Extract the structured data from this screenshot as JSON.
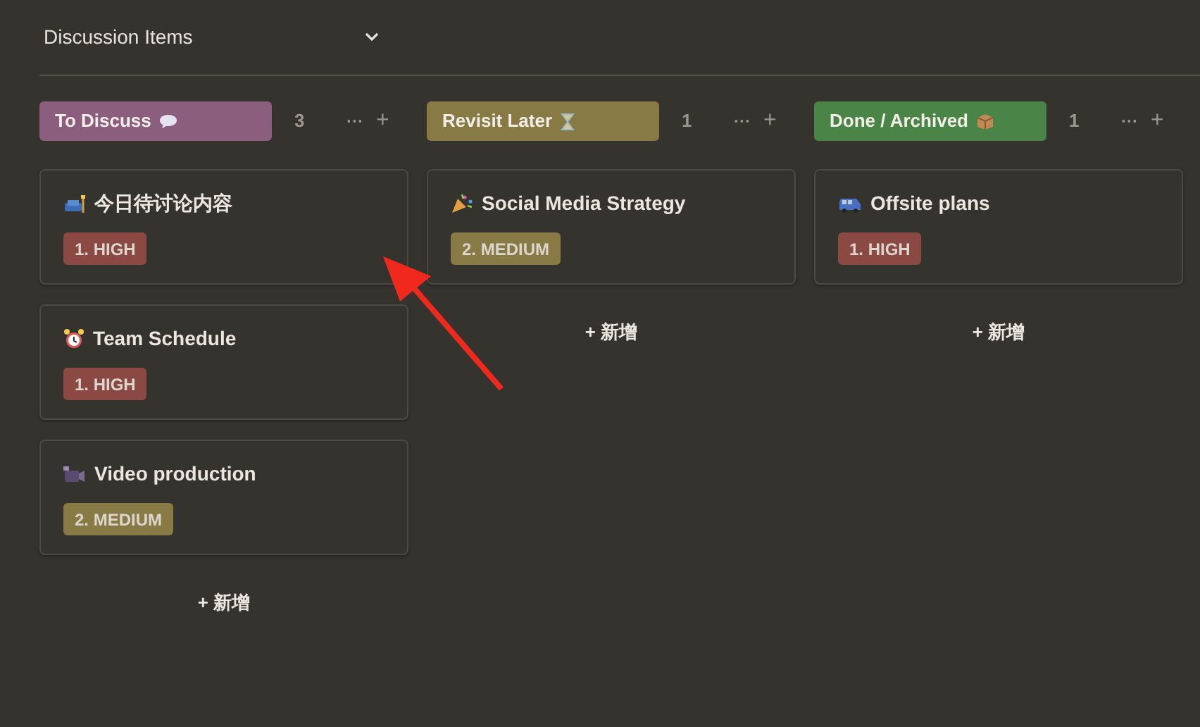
{
  "view": {
    "title": "Discussion Items"
  },
  "columns": [
    {
      "title": "To Discuss",
      "color": "#8b5e7e",
      "count": "3",
      "more": "···",
      "add": "+",
      "cards": [
        {
          "title": "今日待讨论内容",
          "tag": {
            "label": "1. HIGH",
            "kind": "high"
          }
        },
        {
          "title": "Team Schedule",
          "tag": {
            "label": "1. HIGH",
            "kind": "high"
          }
        },
        {
          "title": "Video production",
          "tag": {
            "label": "2. MEDIUM",
            "kind": "medium"
          }
        }
      ],
      "new_label": "+ 新增"
    },
    {
      "title": "Revisit Later",
      "color": "#877a45",
      "count": "1",
      "more": "···",
      "add": "+",
      "cards": [
        {
          "title": "Social Media Strategy",
          "tag": {
            "label": "2. MEDIUM",
            "kind": "medium"
          }
        }
      ],
      "new_label": "+ 新增"
    },
    {
      "title": "Done / Archived",
      "color": "#4a8447",
      "count": "1",
      "more": "···",
      "add": "+",
      "cards": [
        {
          "title": "Offsite plans",
          "tag": {
            "label": "1. HIGH",
            "kind": "high"
          }
        }
      ],
      "new_label": "+ 新增"
    }
  ]
}
